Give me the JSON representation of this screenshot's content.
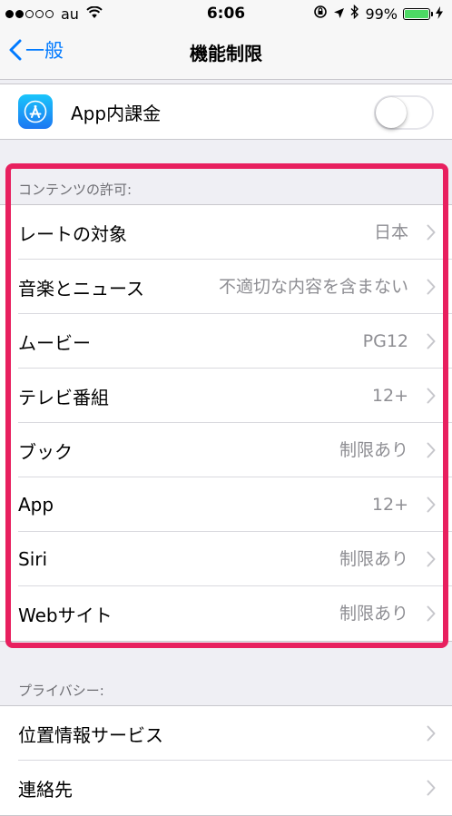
{
  "status_bar": {
    "carrier": "au",
    "time": "6:06",
    "battery_percent": "99%",
    "signal_bars_filled": 2,
    "signal_bars_total": 5
  },
  "nav": {
    "back_label": "一般",
    "title": "機能制限"
  },
  "in_app_purchase": {
    "label": "App内課金",
    "toggle_on": false
  },
  "content_section": {
    "header": "コンテンツの許可:",
    "rows": [
      {
        "label": "レートの対象",
        "value": "日本"
      },
      {
        "label": "音楽とニュース",
        "value": "不適切な内容を含まない"
      },
      {
        "label": "ムービー",
        "value": "PG12"
      },
      {
        "label": "テレビ番組",
        "value": "12+"
      },
      {
        "label": "ブック",
        "value": "制限あり"
      },
      {
        "label": "App",
        "value": "12+"
      },
      {
        "label": "Siri",
        "value": "制限あり"
      },
      {
        "label": "Webサイト",
        "value": "制限あり"
      }
    ]
  },
  "privacy_section": {
    "header": "プライバシー:",
    "rows": [
      {
        "label": "位置情報サービス"
      },
      {
        "label": "連絡先"
      }
    ]
  },
  "colors": {
    "accent": "#007aff",
    "highlight": "#e8205f",
    "battery": "#4cd964"
  }
}
